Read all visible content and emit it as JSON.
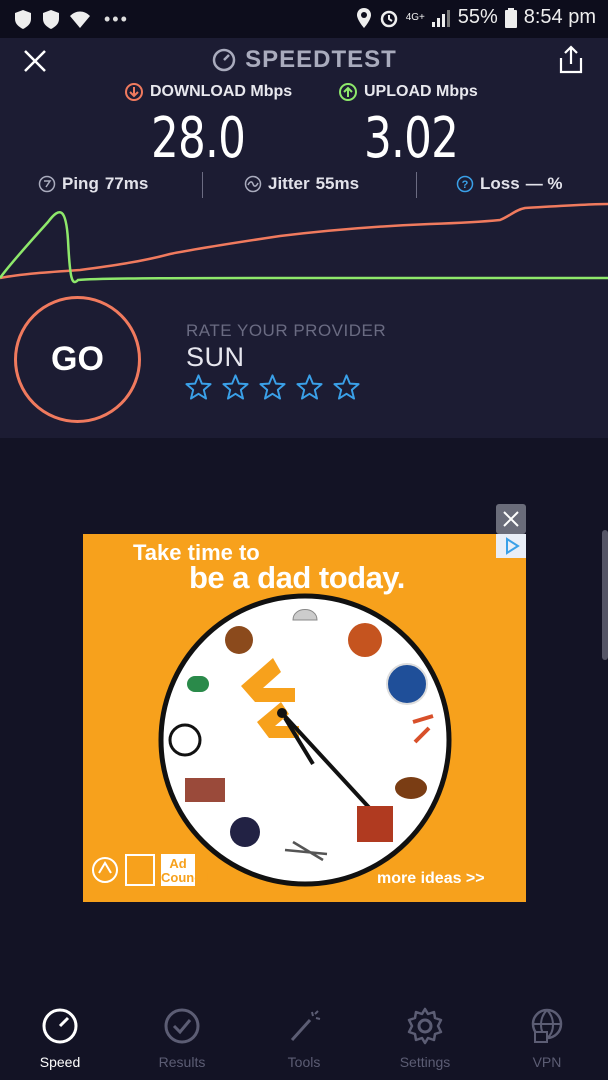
{
  "status_bar": {
    "battery": "55%",
    "time": "8:54 pm",
    "network": "4G+"
  },
  "header": {
    "title": "SPEEDTEST"
  },
  "speeds": {
    "download_label": "DOWNLOAD Mbps",
    "download_value": "28.0",
    "upload_label": "UPLOAD Mbps",
    "upload_value": "3.02"
  },
  "metrics": {
    "ping_label": "Ping",
    "ping_value": "77ms",
    "jitter_label": "Jitter",
    "jitter_value": "55ms",
    "loss_label": "Loss",
    "loss_value": "— %"
  },
  "go_button": {
    "label": "GO"
  },
  "provider": {
    "rate_label": "RATE YOUR PROVIDER",
    "name": "SUN",
    "rating": 0,
    "max_rating": 5
  },
  "ad": {
    "line1": "Take time to",
    "line2": "be a dad today.",
    "more_link": "more ideas >>",
    "council": "Ad Council"
  },
  "bottom_nav": {
    "items": [
      {
        "label": "Speed",
        "icon": "speedometer-icon",
        "active": true
      },
      {
        "label": "Results",
        "icon": "check-circle-icon",
        "active": false
      },
      {
        "label": "Tools",
        "icon": "magic-wand-icon",
        "active": false
      },
      {
        "label": "Settings",
        "icon": "gear-icon",
        "active": false
      },
      {
        "label": "VPN",
        "icon": "vpn-globe-lock-icon",
        "active": false
      }
    ]
  },
  "colors": {
    "download": "#f07a5e",
    "upload": "#8ee86b",
    "background": "#1c1c33",
    "star": "#3aa0e8"
  }
}
